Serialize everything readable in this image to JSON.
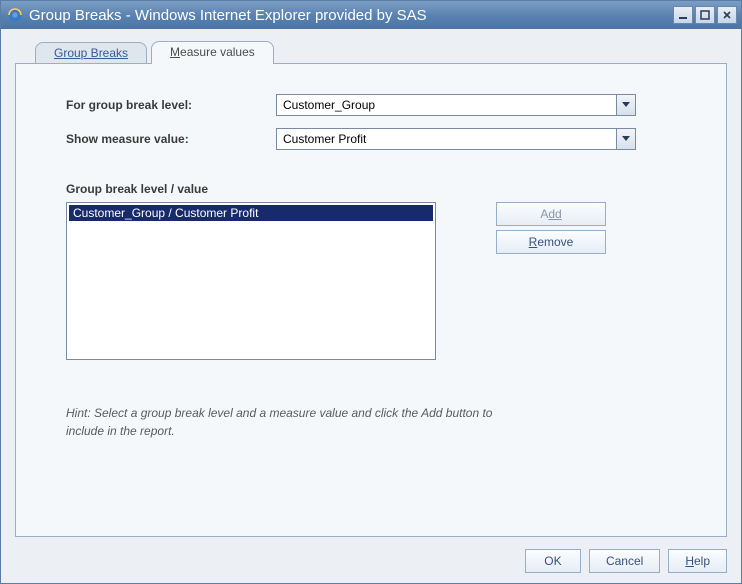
{
  "window": {
    "title": "Group Breaks - Windows Internet Explorer provided by SAS"
  },
  "tabs": {
    "group_breaks": "Group Breaks",
    "measure_values_pre": "M",
    "measure_values_rest": "easure values"
  },
  "form": {
    "group_level_label": "For group break level:",
    "group_level_value": "Customer_Group",
    "measure_label": "Show measure value:",
    "measure_value": "Customer Profit",
    "list_label": "Group break level / value",
    "list_item_0": "Customer_Group / Customer Profit",
    "add_pre": "A",
    "add_rest": "dd",
    "remove_pre": "R",
    "remove_rest": "emove"
  },
  "hint": "Hint: Select a group break level and a measure value and click the Add button to include in the report.",
  "footer": {
    "ok": "OK",
    "cancel": "Cancel",
    "help_pre": "H",
    "help_rest": "elp"
  }
}
